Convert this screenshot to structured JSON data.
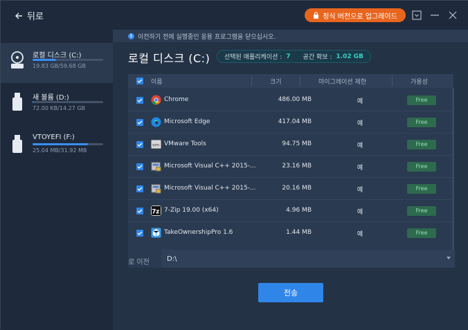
{
  "titlebar": {
    "back_label": "뒤로",
    "upgrade_label": "정식 버전으로 업그레이드"
  },
  "sidebar": {
    "drives": [
      {
        "name": "로컬 디스크 (C:)",
        "size": "19.83 GB/59.68 GB",
        "usage": 0.33,
        "icon": "hard-disk-icon"
      },
      {
        "name": "새 볼륨 (D:)",
        "size": "72.00 KB/14.27 GB",
        "usage": 0.01,
        "icon": "usb-drive-icon"
      },
      {
        "name": "VTOYEFI (F:)",
        "size": "25.04 MB/31.92 MB",
        "usage": 0.78,
        "icon": "usb-drive-icon"
      }
    ]
  },
  "main": {
    "notice": "이전하기 전에 실행중인 응용 프로그램을 닫으십시오.",
    "disk_title": "로컬 디스크 (C:)",
    "selected_label": "선택된 애플리케이션 :",
    "selected_count": "7",
    "space_label": "공간 확보 :",
    "space_value": "1.02 GB",
    "columns": {
      "name": "이름",
      "size": "크기",
      "migration": "마이그레이션 제한",
      "availability": "가용성"
    },
    "apps": [
      {
        "name": "Chrome",
        "size": "486.00 MB",
        "migration": "예",
        "availability": "Free",
        "icon": "chrome-icon"
      },
      {
        "name": "Microsoft Edge",
        "size": "417.04 MB",
        "migration": "예",
        "availability": "Free",
        "icon": "edge-icon"
      },
      {
        "name": "VMware Tools",
        "size": "94.75 MB",
        "migration": "예",
        "availability": "Free",
        "icon": "vmware-icon"
      },
      {
        "name": "Microsoft Visual C++ 2015-...",
        "size": "23.16 MB",
        "migration": "예",
        "availability": "Free",
        "icon": "installer-icon"
      },
      {
        "name": "Microsoft Visual C++ 2015-...",
        "size": "20.16 MB",
        "migration": "예",
        "availability": "Free",
        "icon": "installer-icon"
      },
      {
        "name": "7-Zip 19.00 (x64)",
        "size": "4.96 MB",
        "migration": "예",
        "availability": "Free",
        "icon": "7zip-icon"
      },
      {
        "name": "TakeOwnershipPro 1.6",
        "size": "1.44 MB",
        "migration": "예",
        "availability": "Free",
        "icon": "takeownership-icon"
      }
    ],
    "destination_label": "로 이전",
    "destination_value": "D:\\",
    "transfer_label": "전송"
  },
  "colors": {
    "accent": "#2f86e8",
    "upgrade": "#e8651e",
    "free_badge_bg": "#2e6a4e",
    "free_badge_text": "#8fe0b0",
    "summary_number": "#39d0c0"
  }
}
